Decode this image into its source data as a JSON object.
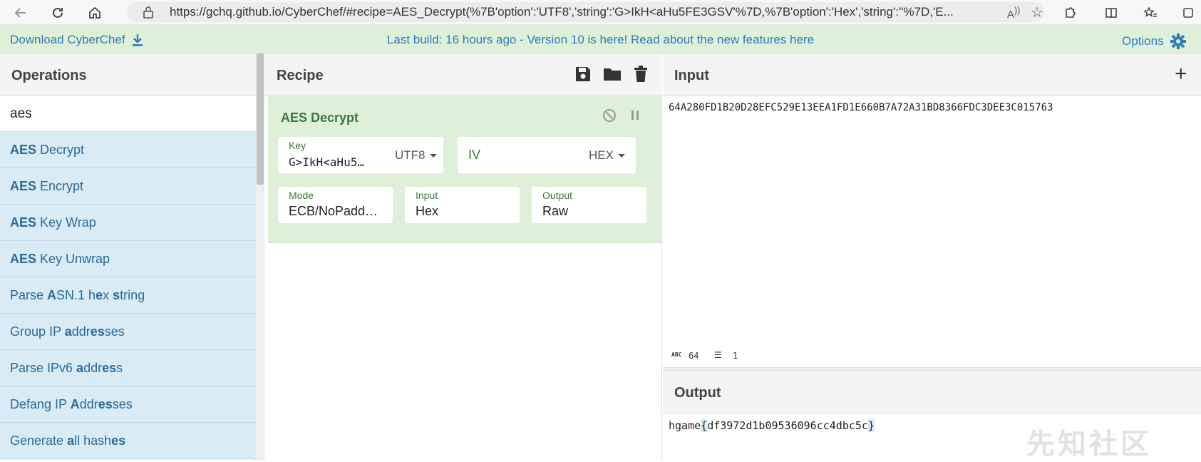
{
  "browser": {
    "url": "https://gchq.github.io/CyberChef/#recipe=AES_Decrypt(%7B'option':'UTF8','string':'G>IkH<aHu5FE3GSV'%7D,%7B'option':'Hex','string':''%7D,'E..."
  },
  "banner": {
    "download": "Download CyberChef",
    "message": "Last build: 16 hours ago - Version 10 is here! Read about the new features here",
    "options": "Options"
  },
  "operations": {
    "title": "Operations",
    "search": "aes",
    "items": [
      {
        "pre": "",
        "match": "AES",
        "post": " Decrypt"
      },
      {
        "pre": "",
        "match": "AES",
        "post": " Encrypt"
      },
      {
        "pre": "",
        "match": "AES",
        "post": " Key Wrap"
      },
      {
        "pre": "",
        "match": "AES",
        "post": " Key Unwrap"
      },
      {
        "pre": "Parse ",
        "match": "A",
        "post": "SN.1 h",
        "match2": "e",
        "post2": "x ",
        "match3": "s",
        "post3": "tring"
      },
      {
        "pre": "Group IP ",
        "match": "a",
        "post": "ddr",
        "match2": "es",
        "post2": "ses",
        "match3": "",
        "post3": ""
      },
      {
        "pre": "Parse IPv6 ",
        "match": "a",
        "post": "ddr",
        "match2": "es",
        "post2": "s",
        "match3": "",
        "post3": ""
      },
      {
        "pre": "Defang IP ",
        "match": "A",
        "post": "ddr",
        "match2": "es",
        "post2": "ses",
        "match3": "",
        "post3": ""
      },
      {
        "pre": "Generate ",
        "match": "a",
        "post": "ll hash",
        "match2": "es",
        "post2": "",
        "match3": "",
        "post3": ""
      }
    ]
  },
  "recipe": {
    "title": "Recipe",
    "ingredient": {
      "name": "AES Decrypt",
      "key_label": "Key",
      "key_value": "G>IkH<aHu5…",
      "key_format": "UTF8",
      "iv_label": "IV",
      "iv_format": "HEX",
      "mode_label": "Mode",
      "mode_value": "ECB/NoPadd…",
      "input_label": "Input",
      "input_value": "Hex",
      "output_label": "Output",
      "output_value": "Raw"
    }
  },
  "input": {
    "title": "Input",
    "text": "64A280FD1B20D28EFC529E13EEA1FD1E660B7A72A31BD8366FDC3DEE3C015763",
    "char_count": "64",
    "line_count": "1"
  },
  "output": {
    "title": "Output",
    "text_pre": "hgame",
    "text_open": "{",
    "text_body": "df3972d1b09536096cc4dbc5c",
    "text_close": "}"
  },
  "watermark": "先知社区",
  "colors": {
    "banner_bg": "#dff0d8",
    "op_bg": "#d9ebf5",
    "ingredient_bg": "#dff0d8",
    "link": "#337ab7"
  }
}
